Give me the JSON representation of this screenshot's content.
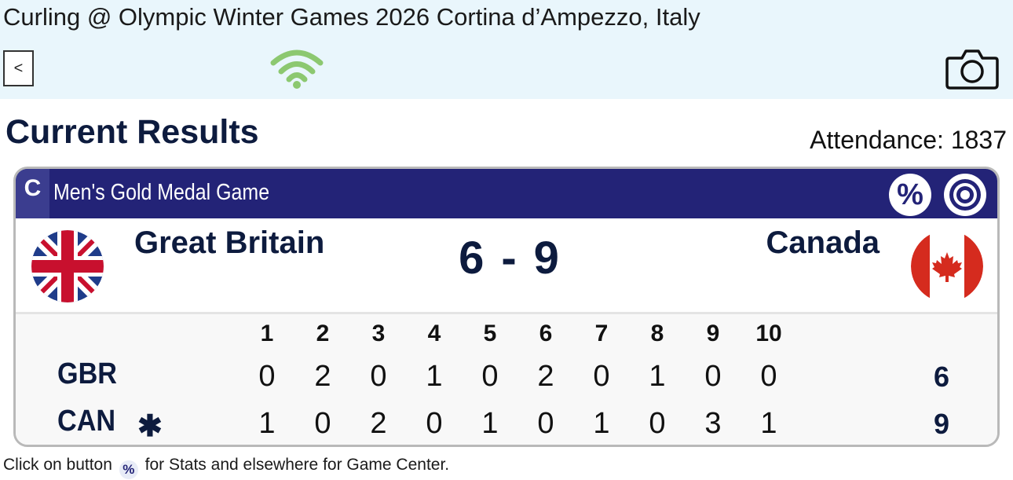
{
  "header": {
    "title": "Curling @ Olympic Winter Games 2026 Cortina d’Ampezzo, Italy",
    "back_label": "<",
    "wifi_icon": "wifi-icon",
    "camera_icon": "camera-icon",
    "wifi_color": "#8cc870"
  },
  "page": {
    "title": "Current Results",
    "attendance": "Attendance: 1837"
  },
  "game": {
    "badge": "C",
    "name": "Men's Gold Medal Game",
    "stats_label": "%",
    "target_icon": "target-icon",
    "header_color": "#232377",
    "team_left": {
      "name": "Great Britain",
      "abbr": "GBR",
      "flag": "union-jack-flag",
      "total": "6",
      "hammer": ""
    },
    "team_right": {
      "name": "Canada",
      "abbr": "CAN",
      "flag": "maple-leaf-flag",
      "total": "9",
      "hammer": "✱"
    },
    "score_left": "6",
    "score_sep": "-",
    "score_right": "9",
    "ends": [
      "1",
      "2",
      "3",
      "4",
      "5",
      "6",
      "7",
      "8",
      "9",
      "10"
    ],
    "rows": [
      {
        "abbr": "GBR",
        "hammer": "",
        "scores": [
          "0",
          "2",
          "0",
          "1",
          "0",
          "2",
          "0",
          "1",
          "0",
          "0"
        ],
        "total": "6"
      },
      {
        "abbr": "CAN",
        "hammer": "✱",
        "scores": [
          "1",
          "0",
          "2",
          "0",
          "1",
          "0",
          "1",
          "0",
          "3",
          "1"
        ],
        "total": "9"
      }
    ]
  },
  "footer": {
    "text_before": "Click on button",
    "button": "%",
    "text_after": "for Stats and elsewhere for Game Center."
  }
}
